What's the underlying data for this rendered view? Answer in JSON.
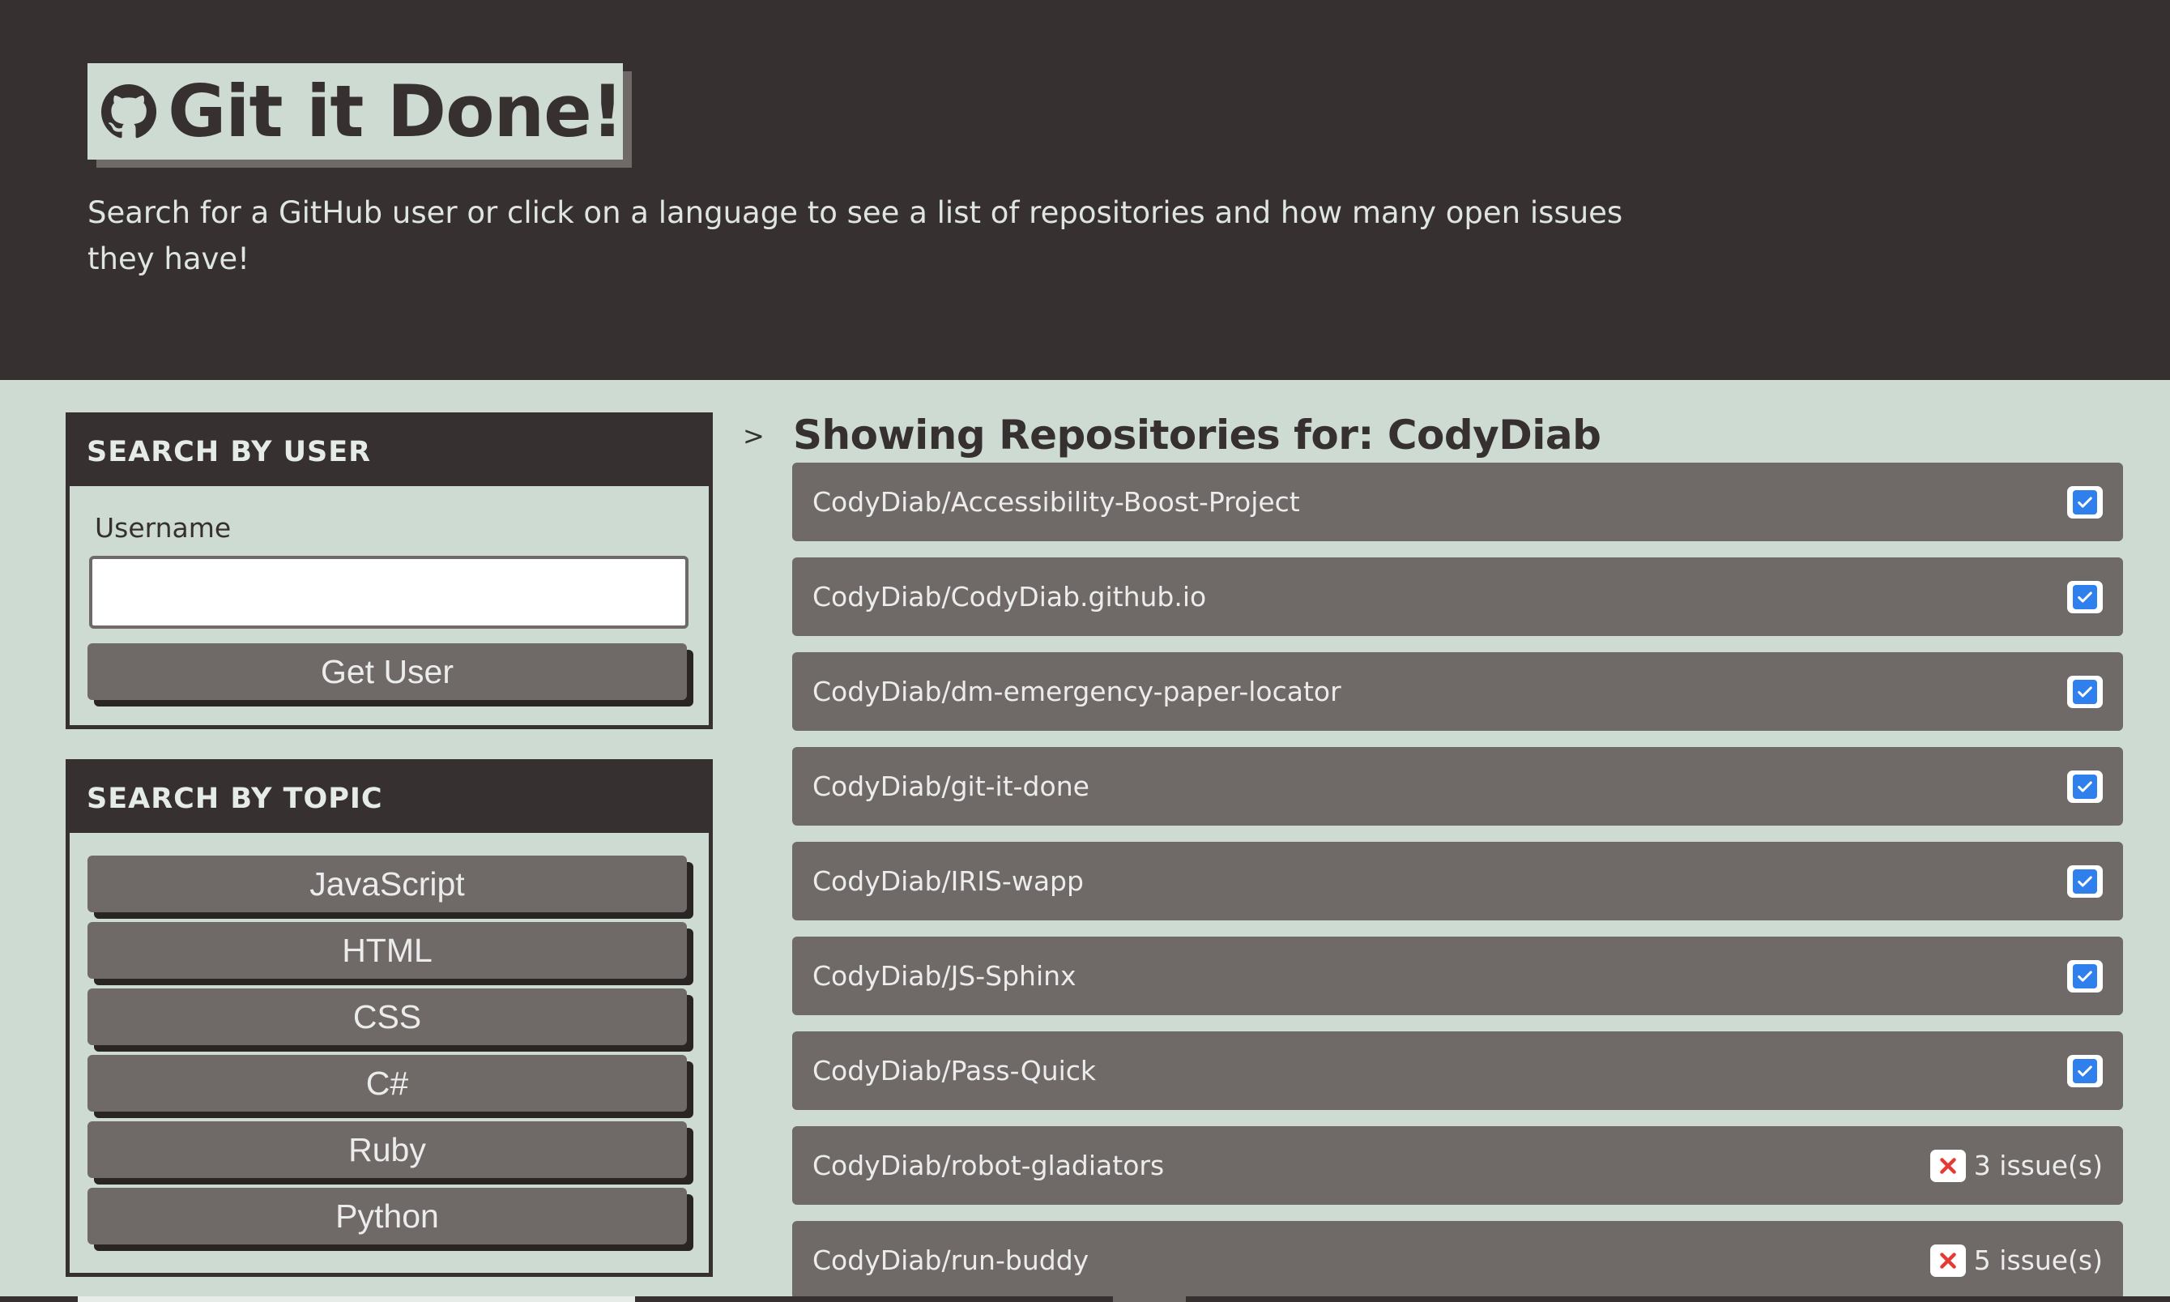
{
  "header": {
    "title": "Git it Done!",
    "logo_icon": "github-icon",
    "tagline": "Search for a GitHub user or click on a language to see a list of repositories and how many open issues they have!"
  },
  "user_search": {
    "heading": "SEARCH BY USER",
    "label": "Username",
    "value": "",
    "placeholder": "",
    "button": "Get User"
  },
  "topic_search": {
    "heading": "SEARCH BY TOPIC",
    "topics": [
      "JavaScript",
      "HTML",
      "CSS",
      "C#",
      "Ruby",
      "Python"
    ]
  },
  "results": {
    "chevron": ">",
    "title": "Showing Repositories for: CodyDiab",
    "repos": [
      {
        "name": "CodyDiab/Accessibility-Boost-Project",
        "status": "check-icon",
        "issues": ""
      },
      {
        "name": "CodyDiab/CodyDiab.github.io",
        "status": "check-icon",
        "issues": ""
      },
      {
        "name": "CodyDiab/dm-emergency-paper-locator",
        "status": "check-icon",
        "issues": ""
      },
      {
        "name": "CodyDiab/git-it-done",
        "status": "check-icon",
        "issues": ""
      },
      {
        "name": "CodyDiab/IRIS-wapp",
        "status": "check-icon",
        "issues": ""
      },
      {
        "name": "CodyDiab/JS-Sphinx",
        "status": "check-icon",
        "issues": ""
      },
      {
        "name": "CodyDiab/Pass-Quick",
        "status": "check-icon",
        "issues": ""
      },
      {
        "name": "CodyDiab/robot-gladiators",
        "status": "x-icon",
        "issues": "3 issue(s)"
      },
      {
        "name": "CodyDiab/run-buddy",
        "status": "x-icon",
        "issues": "5 issue(s)"
      }
    ]
  },
  "colors": {
    "dark": "#373030",
    "background": "#cddbd3",
    "item": "#6f6968",
    "check": "#2f80ed",
    "error": "#e53935"
  }
}
